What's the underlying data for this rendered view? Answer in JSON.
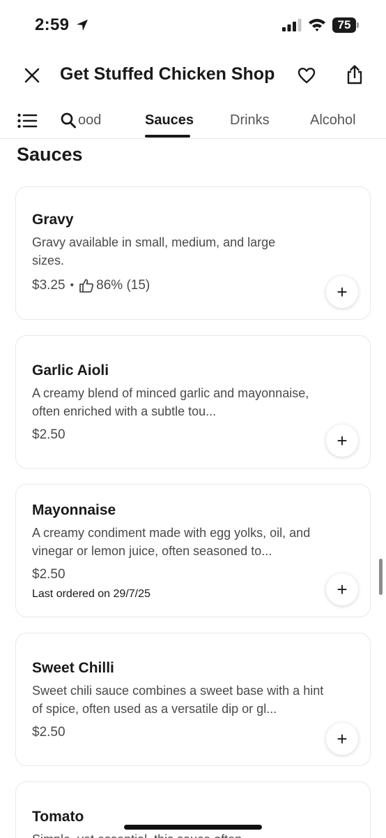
{
  "status_bar": {
    "time": "2:59",
    "battery": "75"
  },
  "header": {
    "title": "Get Stuffed Chicken Shop"
  },
  "tabs": [
    {
      "label": "ood"
    },
    {
      "label": "Sauces"
    },
    {
      "label": "Drinks"
    },
    {
      "label": "Alcohol"
    }
  ],
  "section": {
    "title": "Sauces"
  },
  "items": [
    {
      "name": "Gravy",
      "description": "Gravy available in small, medium, and large sizes.",
      "price": "$3.25",
      "rating": "86% (15)"
    },
    {
      "name": "Garlic Aioli",
      "description": "A creamy blend of minced garlic and mayonnaise, often enriched with a subtle tou...",
      "price": "$2.50"
    },
    {
      "name": "Mayonnaise",
      "description": "A creamy condiment made with egg yolks, oil, and vinegar or lemon juice, often seasoned to...",
      "price": "$2.50",
      "last_ordered": "Last ordered on 29/7/25"
    },
    {
      "name": "Sweet Chilli",
      "description": "Sweet chili sauce combines a sweet base with a hint of spice, often used as a versatile dip or gl...",
      "price": "$2.50"
    },
    {
      "name": "Tomato",
      "description": "Simple, yet essential, this sauce often..."
    }
  ],
  "add_label": "+",
  "bullet": "•",
  "icons": {
    "location": "location-arrow-icon",
    "close": "close-icon",
    "favorite": "heart-icon",
    "share": "share-icon",
    "menu": "list-icon",
    "search": "search-icon",
    "rating": "thumbs-up-icon"
  }
}
